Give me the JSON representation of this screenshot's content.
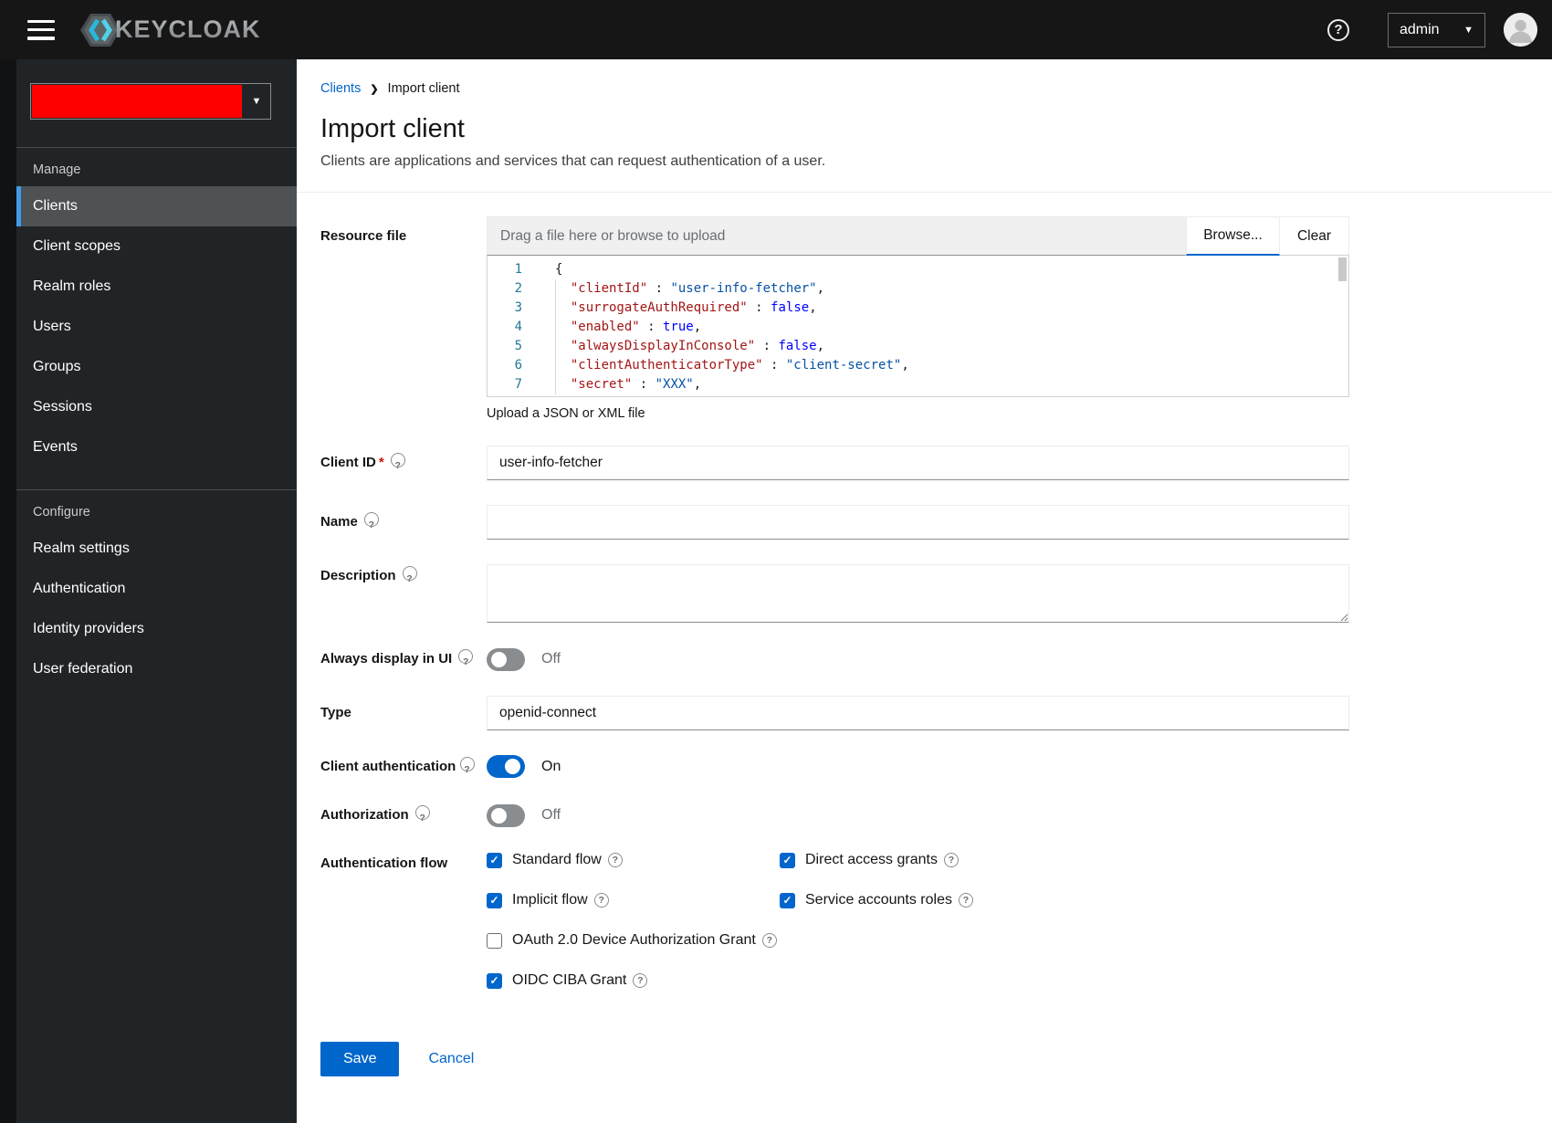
{
  "header": {
    "brand": "KEYCLOAK",
    "user": "admin"
  },
  "sidebar": {
    "realm_color": "#ff0000",
    "active_item": "Clients",
    "active_accent": "#3f9ce8",
    "sections": [
      {
        "title": "Manage",
        "items": [
          "Clients",
          "Client scopes",
          "Realm roles",
          "Users",
          "Groups",
          "Sessions",
          "Events"
        ]
      },
      {
        "title": "Configure",
        "items": [
          "Realm settings",
          "Authentication",
          "Identity providers",
          "User federation"
        ]
      }
    ]
  },
  "breadcrumb": {
    "items": [
      "Clients",
      "Import client"
    ]
  },
  "page": {
    "title": "Import client",
    "subtitle": "Clients are applications and services that can request authentication of a user."
  },
  "colors": {
    "accent": "#0066cc",
    "switch_off": "#8a8d90",
    "syntax_key": "#a31515",
    "syntax_string": "#0451a5",
    "syntax_bool": "#0000ff",
    "line_number": "#237893"
  },
  "form": {
    "resource_file": {
      "label": "Resource file",
      "placeholder": "Drag a file here or browse to upload",
      "browse_label": "Browse...",
      "clear_label": "Clear",
      "helper": "Upload a JSON or XML file",
      "code_lines": [
        {
          "n": "1",
          "guide": false,
          "tokens": [
            [
              "p",
              "{"
            ]
          ]
        },
        {
          "n": "2",
          "guide": true,
          "tokens": [
            [
              "p",
              "  "
            ],
            [
              "k",
              "\"clientId\""
            ],
            [
              "p",
              " : "
            ],
            [
              "s",
              "\"user-info-fetcher\""
            ],
            [
              "p",
              ","
            ]
          ]
        },
        {
          "n": "3",
          "guide": true,
          "tokens": [
            [
              "p",
              "  "
            ],
            [
              "k",
              "\"surrogateAuthRequired\""
            ],
            [
              "p",
              " : "
            ],
            [
              "b",
              "false"
            ],
            [
              "p",
              ","
            ]
          ]
        },
        {
          "n": "4",
          "guide": true,
          "tokens": [
            [
              "p",
              "  "
            ],
            [
              "k",
              "\"enabled\""
            ],
            [
              "p",
              " : "
            ],
            [
              "b",
              "true"
            ],
            [
              "p",
              ","
            ]
          ]
        },
        {
          "n": "5",
          "guide": true,
          "tokens": [
            [
              "p",
              "  "
            ],
            [
              "k",
              "\"alwaysDisplayInConsole\""
            ],
            [
              "p",
              " : "
            ],
            [
              "b",
              "false"
            ],
            [
              "p",
              ","
            ]
          ]
        },
        {
          "n": "6",
          "guide": true,
          "tokens": [
            [
              "p",
              "  "
            ],
            [
              "k",
              "\"clientAuthenticatorType\""
            ],
            [
              "p",
              " : "
            ],
            [
              "s",
              "\"client-secret\""
            ],
            [
              "p",
              ","
            ]
          ]
        },
        {
          "n": "7",
          "guide": true,
          "tokens": [
            [
              "p",
              "  "
            ],
            [
              "k",
              "\"secret\""
            ],
            [
              "p",
              " : "
            ],
            [
              "s",
              "\"XXX\""
            ],
            [
              "p",
              ","
            ]
          ]
        }
      ]
    },
    "client_id": {
      "label": "Client ID",
      "required": "*",
      "value": "user-info-fetcher"
    },
    "name": {
      "label": "Name",
      "value": ""
    },
    "description": {
      "label": "Description",
      "value": ""
    },
    "always_display": {
      "label": "Always display in UI",
      "state": "Off"
    },
    "type": {
      "label": "Type",
      "value": "openid-connect"
    },
    "client_auth": {
      "label": "Client authentication",
      "state": "On"
    },
    "authorization": {
      "label": "Authorization",
      "state": "Off"
    },
    "auth_flow": {
      "label": "Authentication flow",
      "options": [
        {
          "label": "Standard flow",
          "checked": true,
          "col": 1
        },
        {
          "label": "Direct access grants",
          "checked": true,
          "col": 2
        },
        {
          "label": "Implicit flow",
          "checked": true,
          "col": 1
        },
        {
          "label": "Service accounts roles",
          "checked": true,
          "col": 2
        },
        {
          "label": "OAuth 2.0 Device Authorization Grant",
          "checked": false,
          "col": 1
        },
        {
          "label": "OIDC CIBA Grant",
          "checked": true,
          "col": 1
        }
      ]
    },
    "actions": {
      "save": "Save",
      "cancel": "Cancel"
    }
  }
}
